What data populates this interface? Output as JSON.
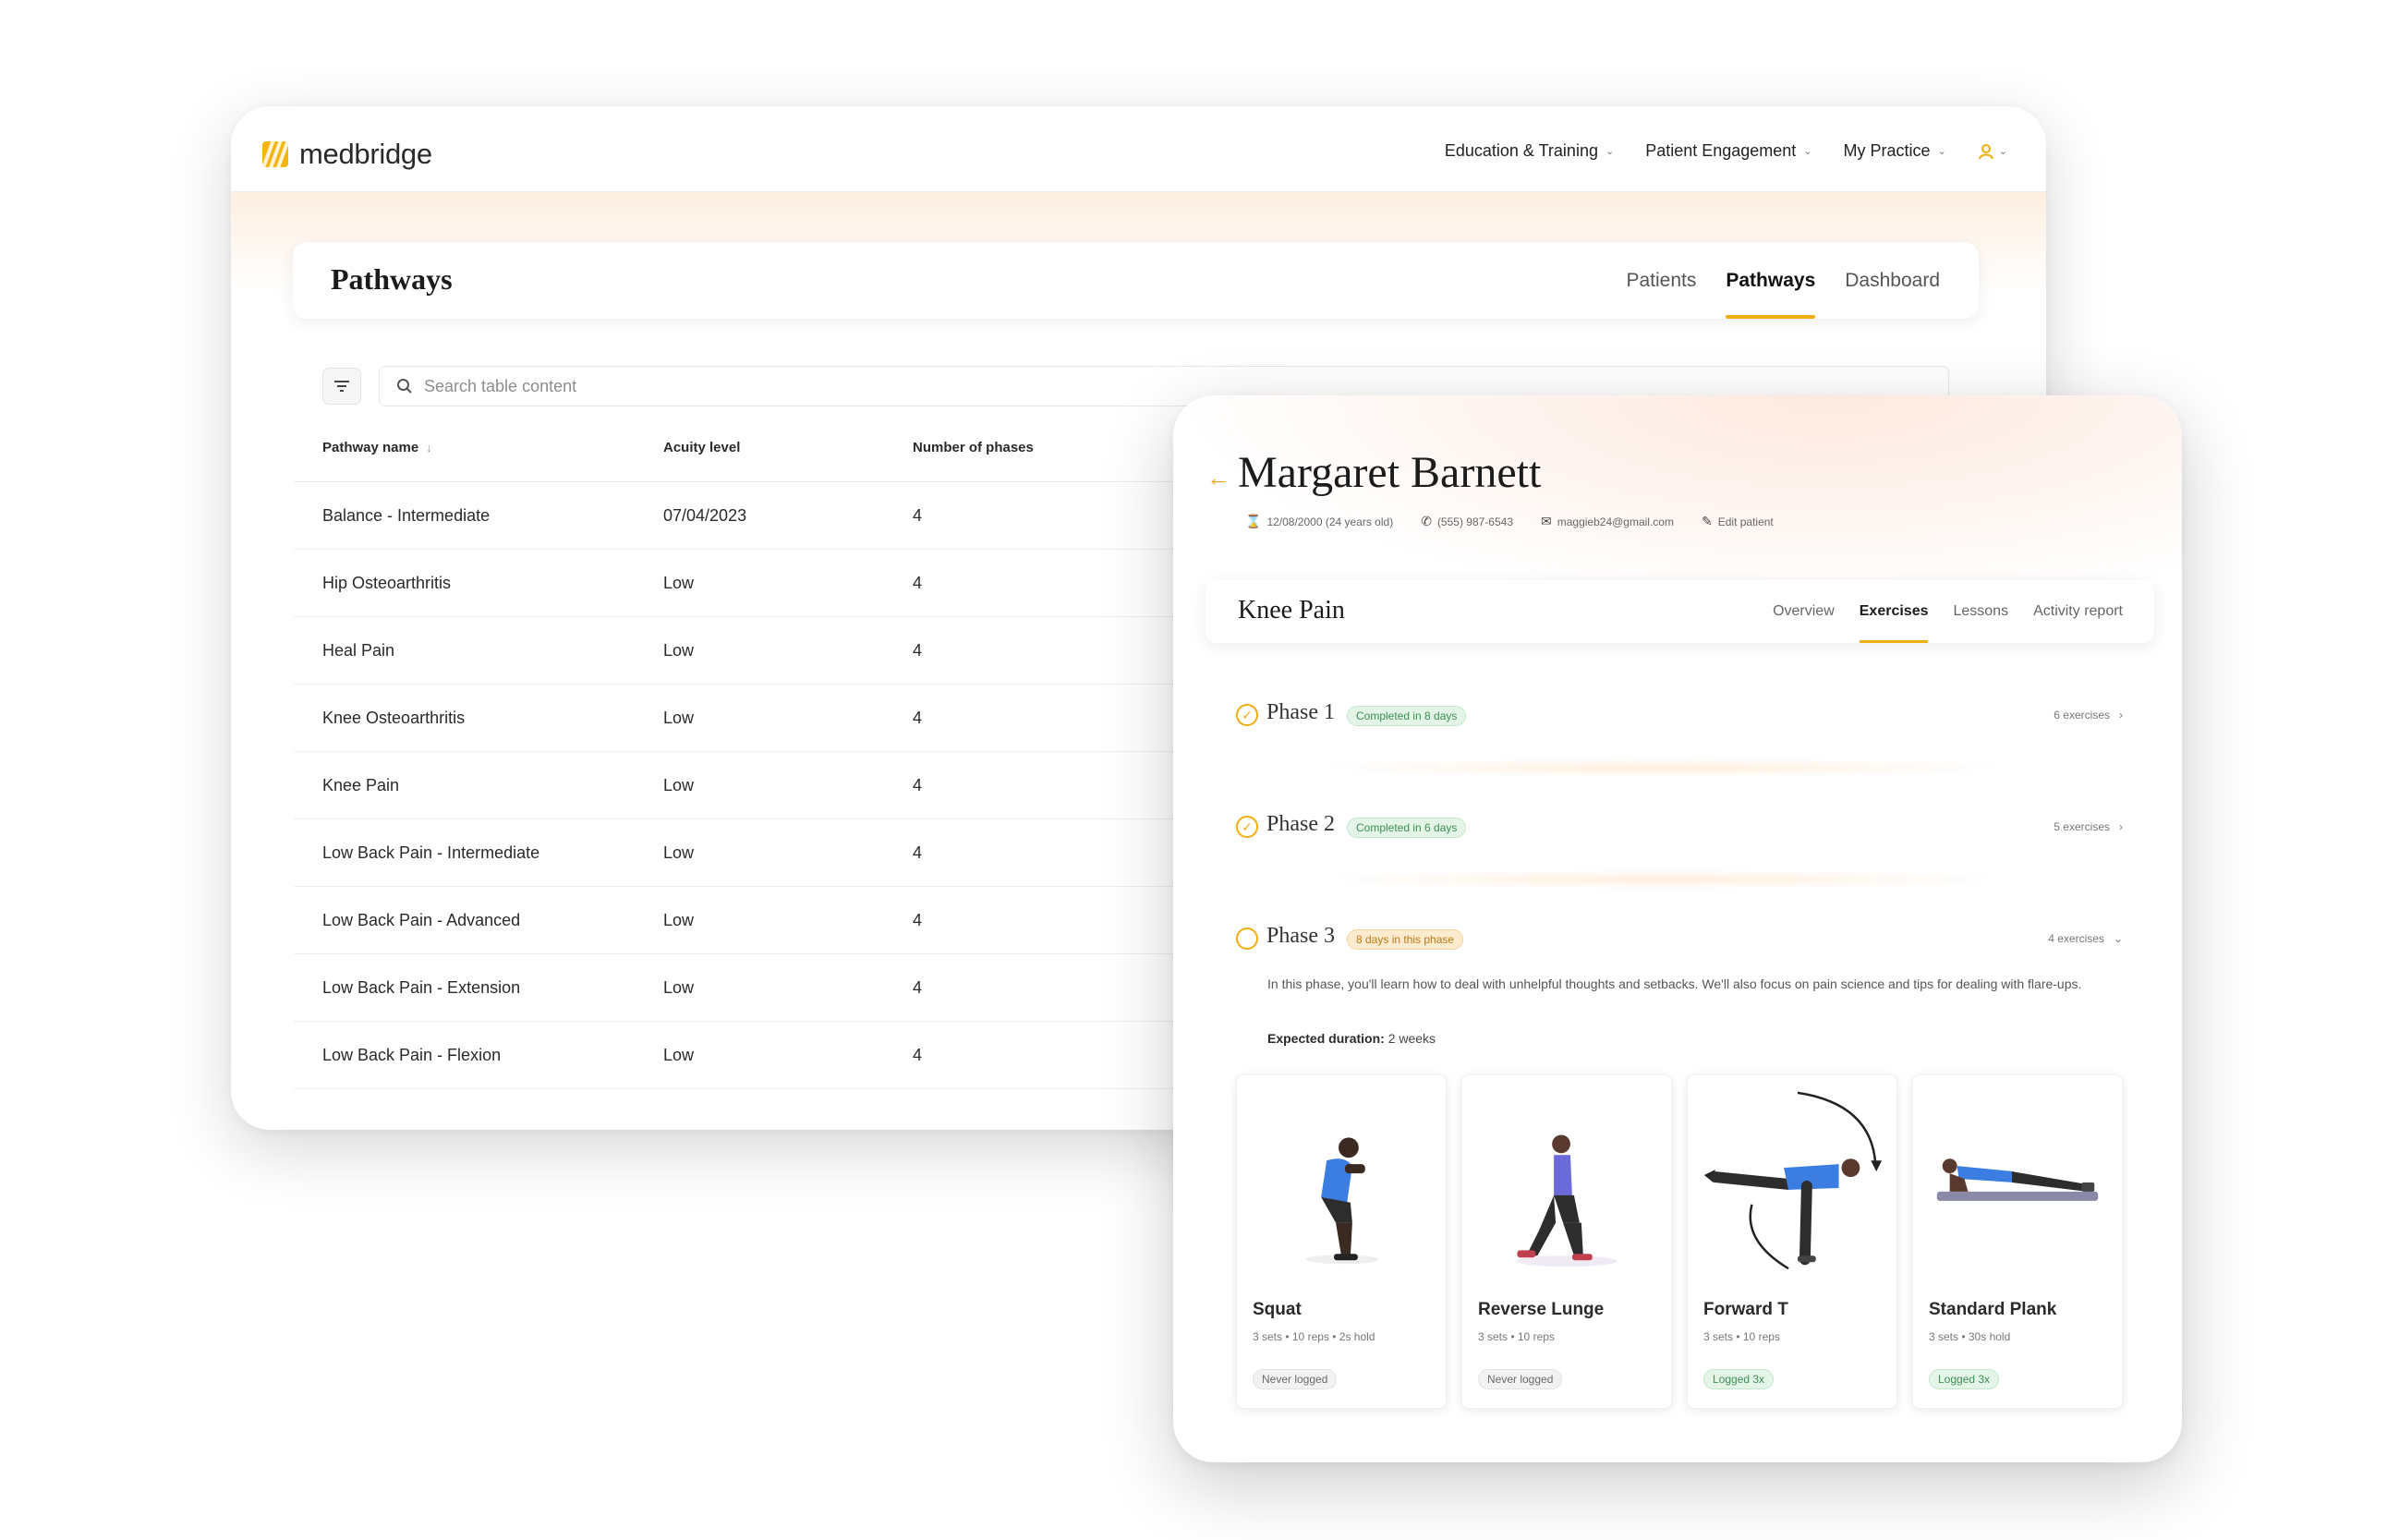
{
  "colors": {
    "accent": "#f2ad0f",
    "success": "#3b8f55",
    "badge_orange": "#fdebcf"
  },
  "brand": {
    "name": "medbridge",
    "icon": "medbridge-logo-icon"
  },
  "top_nav": {
    "items": [
      {
        "label": "Education & Training",
        "icon": "chevron-down-icon"
      },
      {
        "label": "Patient Engagement",
        "icon": "chevron-down-icon"
      },
      {
        "label": "My Practice",
        "icon": "chevron-down-icon"
      }
    ],
    "user_icon": "user-icon"
  },
  "page": {
    "title": "Pathways",
    "tabs": [
      {
        "label": "Patients",
        "active": false
      },
      {
        "label": "Pathways",
        "active": true
      },
      {
        "label": "Dashboard",
        "active": false
      }
    ]
  },
  "toolbar": {
    "filter_icon": "filter-icon",
    "search_placeholder": "Search table content"
  },
  "table": {
    "columns": [
      "Pathway name",
      "Acuity level",
      "Number of phases"
    ],
    "rows": [
      [
        "Balance - Intermediate",
        "07/04/2023",
        "4"
      ],
      [
        "Hip Osteoarthritis",
        "Low",
        "4"
      ],
      [
        "Heal Pain",
        "Low",
        "4"
      ],
      [
        "Knee Osteoarthritis",
        "Low",
        "4"
      ],
      [
        "Knee Pain",
        "Low",
        "4"
      ],
      [
        "Low Back Pain - Intermediate",
        "Low",
        "4"
      ],
      [
        "Low Back Pain - Advanced",
        "Low",
        "4"
      ],
      [
        "Low Back Pain - Extension",
        "Low",
        "4"
      ],
      [
        "Low Back Pain - Flexion",
        "Low",
        "4"
      ]
    ]
  },
  "patient": {
    "name": "Margaret Barnett",
    "dob": "12/08/2000 (24 years old)",
    "phone": "(555) 987-6543",
    "email": "maggieb24@gmail.com",
    "edit_label": "Edit patient"
  },
  "pathway": {
    "title": "Knee Pain",
    "tabs": [
      {
        "label": "Overview",
        "active": false
      },
      {
        "label": "Exercises",
        "active": true
      },
      {
        "label": "Lessons",
        "active": false
      },
      {
        "label": "Activity report",
        "active": false
      }
    ],
    "phases": [
      {
        "name": "Phase 1",
        "badge": "Completed in 8 days",
        "count": "6 exercises",
        "status": "complete"
      },
      {
        "name": "Phase 2",
        "badge": "Completed in 6 days",
        "count": "5 exercises",
        "status": "complete"
      },
      {
        "name": "Phase 3",
        "badge": "8 days in this phase",
        "count": "4 exercises",
        "status": "in-progress"
      }
    ],
    "phase3_description": "In this phase, you'll learn how to deal with unhelpful thoughts and setbacks. We'll also focus on pain science and tips for dealing with flare-ups.",
    "phase3_duration_label": "Expected duration:",
    "phase3_duration_value": "2 weeks",
    "exercises": [
      {
        "name": "Squat",
        "detail": "3 sets • 10 reps • 2s hold",
        "status": "Never logged",
        "logged": false
      },
      {
        "name": "Reverse Lunge",
        "detail": "3 sets • 10 reps",
        "status": "Never logged",
        "logged": false
      },
      {
        "name": "Forward T",
        "detail": "3 sets • 10 reps",
        "status": "Logged 3x",
        "logged": true
      },
      {
        "name": "Standard Plank",
        "detail": "3 sets • 30s hold",
        "status": "Logged 3x",
        "logged": true
      }
    ]
  }
}
